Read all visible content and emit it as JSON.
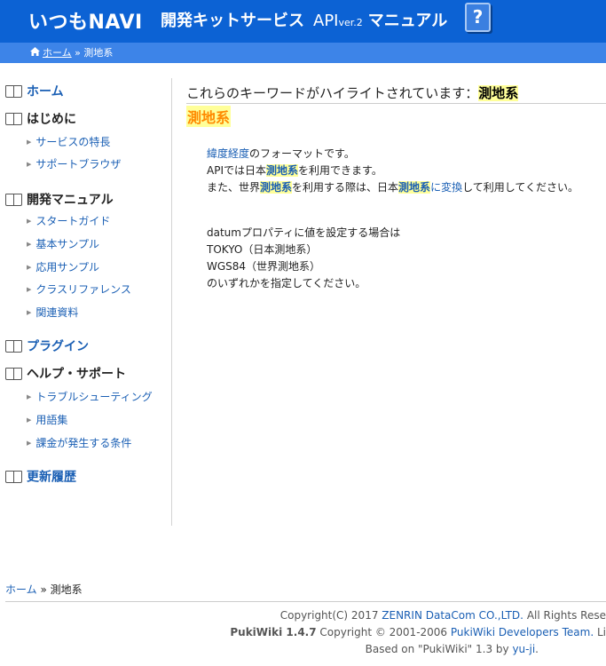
{
  "header": {
    "logo": "いつもNAVI",
    "title_main": "開発キットサービス",
    "title_api": "API",
    "title_ver": "ver.2",
    "title_manual": "マニュアル",
    "help_glyph": "?"
  },
  "breadcrumb_top": {
    "home_icon": "home-icon",
    "home": "ホーム",
    "sep": "»",
    "current": "測地系"
  },
  "sidebar": {
    "home": "ホーム",
    "intro": "はじめに",
    "intro_items": [
      "サービスの特長",
      "サポートブラウザ"
    ],
    "dev_manual": "開発マニュアル",
    "dev_items": [
      "スタートガイド",
      "基本サンプル",
      "応用サンプル",
      "クラスリファレンス",
      "関連資料"
    ],
    "plugin": "プラグイン",
    "help": "ヘルプ・サポート",
    "help_items": [
      "トラブルシューティング",
      "用語集",
      "課金が発生する条件"
    ],
    "history": "更新履歴"
  },
  "main": {
    "search_msg": "これらのキーワードがハイライトされています：",
    "keyword": "測地系",
    "page_title": "測地系",
    "para": {
      "l1_link": "緯度経度",
      "l1_rest": "のフォーマットです。",
      "l2_pre": "APIでは日本",
      "l2_hl": "測地系",
      "l2_post": "を利用できます。",
      "l3_pre": "また、世界",
      "l3_hl": "測地系",
      "l3_mid": "を利用する際は、日本",
      "l3_hl2": "測地系",
      "l3_kw": "に変換",
      "l3_post": "して利用してください。"
    },
    "datum": {
      "l1": "datumプロパティに値を設定する場合は",
      "l2": "TOKYO（日本測地系）",
      "l3": "WGS84（世界測地系）",
      "l4": "のいずれかを指定してください。"
    }
  },
  "footer": {
    "crumb_home": "ホーム",
    "crumb_sep": "»",
    "crumb_current": "測地系",
    "copyright_pre": "Copyright(C) 2017 ",
    "copyright_link": "ZENRIN DataCom CO.,LTD.",
    "copyright_post": " All Rights Rese",
    "pukiwiki_name": "PukiWiki 1.4.7",
    "pukiwiki_mid": " Copyright © 2001-2006 ",
    "pukiwiki_link": "PukiWiki Developers Team.",
    "pukiwiki_post": " Li",
    "based_pre": "Based on \"PukiWiki\" 1.3 by ",
    "based_link": "yu-ji",
    "based_post": "."
  }
}
